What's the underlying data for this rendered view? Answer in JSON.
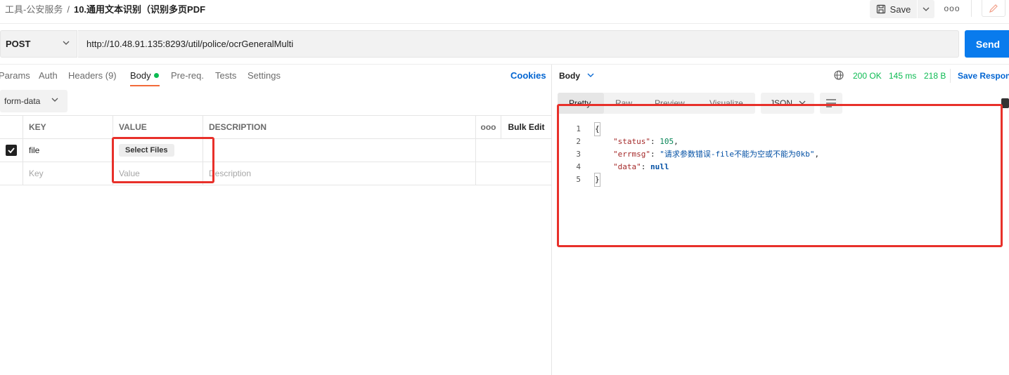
{
  "breadcrumb": {
    "parent": "工具-公安服务",
    "separator": "/",
    "current": "10.通用文本识别（识别多页PDF"
  },
  "toolbar": {
    "save_label": "Save",
    "more_label": "ooo"
  },
  "request": {
    "method": "POST",
    "url": "http://10.48.91.135:8293/util/police/ocrGeneralMulti",
    "send_label": "Send"
  },
  "tabs": {
    "params": "Params",
    "auth": "Auth",
    "headers": "Headers (9)",
    "body": "Body",
    "prereq": "Pre-req.",
    "tests": "Tests",
    "settings": "Settings",
    "cookies": "Cookies"
  },
  "body_mode": "form-data",
  "table": {
    "headers": {
      "key": "KEY",
      "value": "VALUE",
      "description": "DESCRIPTION",
      "more": "ooo",
      "bulk_edit": "Bulk Edit"
    },
    "rows": [
      {
        "key": "file",
        "value_button": "Select Files",
        "checked": true
      }
    ],
    "placeholders": {
      "key": "Key",
      "value": "Value",
      "description": "Description"
    }
  },
  "response": {
    "body_label": "Body",
    "status": "200 OK",
    "time": "145 ms",
    "size": "218 B",
    "save_label": "Save Respon",
    "view_tabs": [
      "Pretty",
      "Raw",
      "Preview",
      "Visualize"
    ],
    "format": "JSON",
    "line_numbers": [
      "1",
      "2",
      "3",
      "4",
      "5"
    ],
    "json": {
      "open": "{",
      "status_key": "\"status\"",
      "status_value": "105",
      "errmsg_key": "\"errmsg\"",
      "errmsg_value": "\"请求参数错误-file不能为空或不能为0kb\"",
      "data_key": "\"data\"",
      "data_value": "null",
      "close": "}"
    }
  },
  "colors": {
    "accent_orange": "#f26b3a",
    "send_blue": "#097bed",
    "status_green": "#0cbb52",
    "annotation_red": "#e8302a"
  }
}
